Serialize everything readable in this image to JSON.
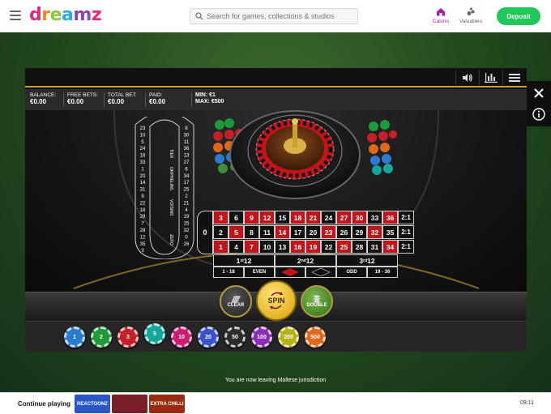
{
  "header": {
    "logo_letters": [
      "d",
      "r",
      "e",
      "a",
      "m",
      "z"
    ],
    "search_placeholder": "Search for games, collections & studios",
    "nav": [
      {
        "label": "Casino",
        "icon": "home-icon",
        "active": true
      },
      {
        "label": "Valuables",
        "icon": "valuables-icon",
        "active": false
      }
    ],
    "deposit_label": "Deposit",
    "accent_color": "#a21caf",
    "deposit_color": "#1ec85a"
  },
  "game": {
    "info": {
      "balance_label": "BALANCE:",
      "balance_value": "€0.00",
      "free_bets_label": "FREE BETS:",
      "free_bets_value": "€0.00",
      "total_bet_label": "TOTAL BET:",
      "total_bet_value": "€0.00",
      "paid_label": "PAID:",
      "paid_value": "€0.00",
      "min_label": "MIN: €1",
      "max_label": "MAX: €500"
    },
    "toolbar_icons": [
      "sound-icon",
      "stats-icon",
      "menu-icon"
    ],
    "racetrack": {
      "numbers": [
        "23",
        "10",
        "5",
        "24",
        "16",
        "33",
        "1",
        "20",
        "14",
        "31",
        "9",
        "22",
        "18",
        "29",
        "7",
        "28",
        "12",
        "35",
        "3",
        "26",
        "0",
        "32",
        "15",
        "19",
        "4",
        "21",
        "2",
        "25",
        "17",
        "34",
        "6",
        "27",
        "13",
        "36",
        "11",
        "30",
        "8"
      ],
      "labels": [
        "TIER",
        "ORPHELINS",
        "VOISINS",
        "ZERO"
      ]
    },
    "grid": {
      "zero": "0",
      "rows": [
        [
          [
            "3",
            "red"
          ],
          [
            "6",
            "black"
          ],
          [
            "9",
            "red"
          ],
          [
            "12",
            "red"
          ],
          [
            "15",
            "black"
          ],
          [
            "18",
            "red"
          ],
          [
            "21",
            "red"
          ],
          [
            "24",
            "black"
          ],
          [
            "27",
            "red"
          ],
          [
            "30",
            "red"
          ],
          [
            "33",
            "black"
          ],
          [
            "36",
            "red"
          ]
        ],
        [
          [
            "2",
            "black"
          ],
          [
            "5",
            "red"
          ],
          [
            "8",
            "black"
          ],
          [
            "11",
            "black"
          ],
          [
            "14",
            "red"
          ],
          [
            "17",
            "black"
          ],
          [
            "20",
            "black"
          ],
          [
            "23",
            "red"
          ],
          [
            "26",
            "black"
          ],
          [
            "29",
            "black"
          ],
          [
            "32",
            "red"
          ],
          [
            "35",
            "black"
          ]
        ],
        [
          [
            "1",
            "red"
          ],
          [
            "4",
            "black"
          ],
          [
            "7",
            "red"
          ],
          [
            "10",
            "black"
          ],
          [
            "13",
            "black"
          ],
          [
            "16",
            "red"
          ],
          [
            "19",
            "red"
          ],
          [
            "22",
            "black"
          ],
          [
            "25",
            "red"
          ],
          [
            "28",
            "black"
          ],
          [
            "31",
            "black"
          ],
          [
            "34",
            "red"
          ]
        ]
      ],
      "columns": [
        "2:1",
        "2:1",
        "2:1"
      ],
      "dozens": [
        {
          "num": "1",
          "sup": "st",
          "rest": " 12"
        },
        {
          "num": "2",
          "sup": "nd",
          "rest": " 12"
        },
        {
          "num": "3",
          "sup": "rd",
          "rest": " 12"
        }
      ],
      "outside": [
        "1 - 18",
        "EVEN",
        "",
        "",
        "ODD",
        "19 - 36"
      ]
    },
    "controls": {
      "clear_label": "CLEAR",
      "spin_label": "SPIN",
      "double_label": "DOUBLE"
    },
    "chips": [
      {
        "value": "1",
        "color": "#2a7bd0"
      },
      {
        "value": "2",
        "color": "#1e9a3a"
      },
      {
        "value": "3",
        "color": "#c32028"
      },
      {
        "value": "5",
        "color": "#14a69a",
        "selected": true
      },
      {
        "value": "10",
        "color": "#cc1b6e"
      },
      {
        "value": "20",
        "color": "#3a53c8"
      },
      {
        "value": "50",
        "color": "#2d2d2d"
      },
      {
        "value": "100",
        "color": "#8a2db8"
      },
      {
        "value": "200",
        "color": "#b8b21a"
      },
      {
        "value": "500",
        "color": "#e0681a"
      }
    ]
  },
  "side": {
    "close_icon": "close-icon",
    "info_icon": "info-icon"
  },
  "notice": "You are now leaving Maltese jurisdiction",
  "bottom": {
    "continue_label": "Continue playing",
    "games": [
      {
        "name": "REACTOONZ",
        "color": "#2a56c9"
      },
      {
        "name": "",
        "color": "#7a1e2a"
      },
      {
        "name": "EXTRA CHILLI",
        "color": "#9a2a10"
      }
    ],
    "clock": "09:11"
  }
}
